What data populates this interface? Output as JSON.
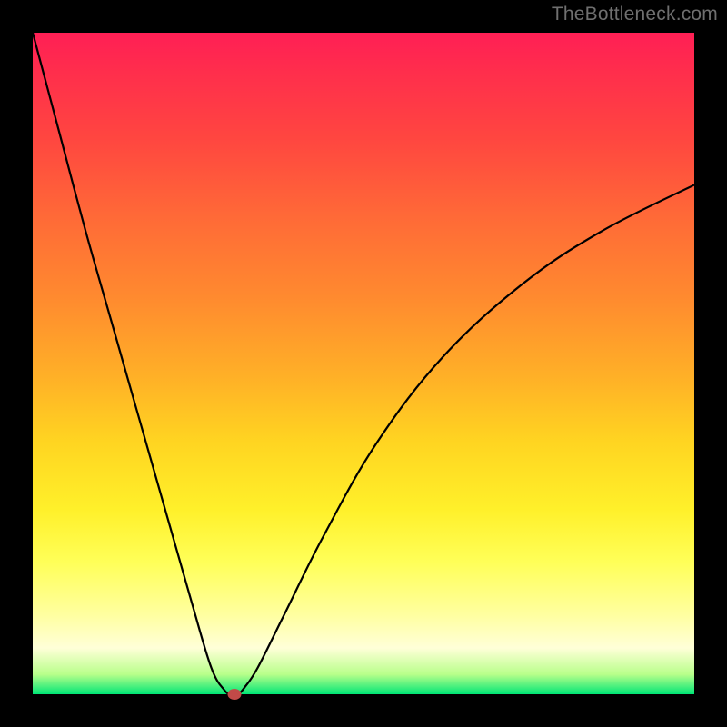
{
  "watermark": "TheBottleneck.com",
  "colors": {
    "curve": "#000000",
    "dot": "#c24a48",
    "frame": "#000000"
  },
  "chart_data": {
    "type": "line",
    "title": "",
    "xlabel": "",
    "ylabel": "",
    "xlim": [
      0,
      100
    ],
    "ylim": [
      0,
      100
    ],
    "grid": false,
    "series": [
      {
        "name": "bottleneck-curve",
        "x": [
          0,
          4,
          8,
          12,
          16,
          20,
          24,
          27,
          29,
          30,
          31,
          32,
          34,
          38,
          44,
          52,
          62,
          74,
          86,
          100
        ],
        "values": [
          100,
          85,
          70,
          56,
          42,
          28,
          14,
          4,
          0.6,
          0,
          0,
          1,
          4,
          12,
          24,
          38,
          51,
          62,
          70,
          77
        ]
      }
    ],
    "annotations": [
      {
        "type": "point",
        "name": "minimum-marker",
        "x": 30.5,
        "y": 0
      }
    ],
    "background_gradient": {
      "top": "#ff1f55",
      "mid": "#ffd521",
      "bottom": "#00e676"
    }
  }
}
